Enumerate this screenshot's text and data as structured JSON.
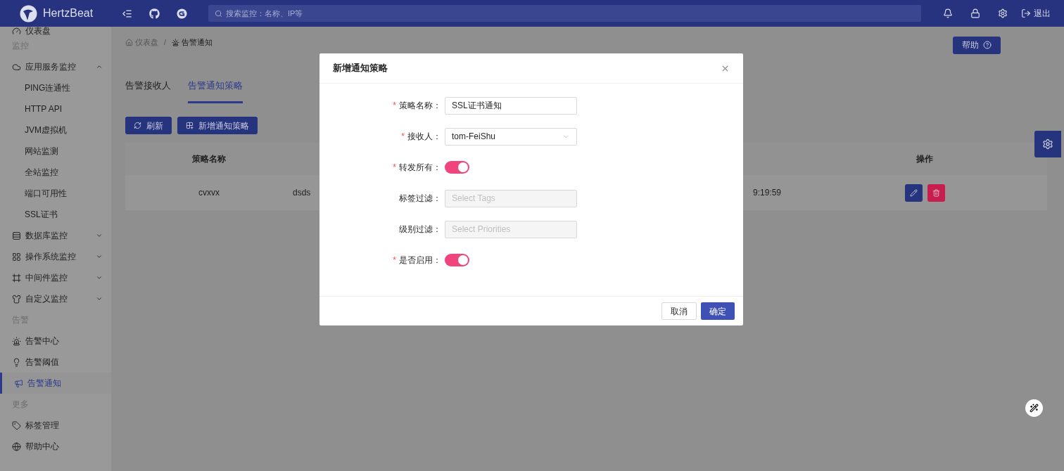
{
  "header": {
    "brand": "HertzBeat",
    "search": {
      "placeholder": "搜索监控：名称、IP等"
    },
    "logout": "退出"
  },
  "sidebar": {
    "items": [
      {
        "kind": "item",
        "label": "仪表盘",
        "selected": false
      },
      {
        "kind": "group",
        "label": "监控"
      },
      {
        "kind": "menu",
        "label": "应用服务监控",
        "expanded": true,
        "children": [
          {
            "label": "PING连通性",
            "selected": false
          },
          {
            "label": "HTTP API",
            "selected": false
          },
          {
            "label": "JVM虚拟机",
            "selected": false
          },
          {
            "label": "网站监测",
            "selected": false
          },
          {
            "label": "全站监控",
            "selected": false
          },
          {
            "label": "端口可用性",
            "selected": false
          },
          {
            "label": "SSL证书",
            "selected": false
          }
        ]
      },
      {
        "kind": "menu",
        "label": "数据库监控",
        "expanded": false
      },
      {
        "kind": "menu",
        "label": "操作系统监控",
        "expanded": false
      },
      {
        "kind": "menu",
        "label": "中间件监控",
        "expanded": false
      },
      {
        "kind": "menu",
        "label": "自定义监控",
        "expanded": false
      },
      {
        "kind": "group",
        "label": "告警"
      },
      {
        "kind": "item",
        "label": "告警中心",
        "selected": false
      },
      {
        "kind": "item",
        "label": "告警阈值",
        "selected": false
      },
      {
        "kind": "item",
        "label": "告警通知",
        "selected": true
      },
      {
        "kind": "group",
        "label": "更多"
      },
      {
        "kind": "item",
        "label": "标签管理",
        "selected": false
      },
      {
        "kind": "item",
        "label": "帮助中心",
        "selected": false
      }
    ]
  },
  "breadcrumb": {
    "items": [
      "仪表盘",
      "告警通知"
    ],
    "separator": "/"
  },
  "help_button": "帮助",
  "tabs": [
    {
      "label": "告警接收人",
      "selected": false
    },
    {
      "label": "告警通知策略",
      "selected": true
    }
  ],
  "toolbar": [
    "刷新",
    "新增通知策略"
  ],
  "table": {
    "columns": {
      "column_1": "策略名称",
      "column_4": "操作"
    },
    "rows": [
      [
        "cvxvx",
        "dsds",
        "9:19:59"
      ]
    ]
  },
  "modal": {
    "title": "新增通知策略",
    "fields": [
      {
        "kind": "input",
        "label": "策略名称：",
        "required_mark": "*",
        "value": "SSL证书通知"
      },
      {
        "kind": "select",
        "label": "接收人：",
        "required_mark": "*",
        "value": "tom-FeiShu",
        "disabled": false
      },
      {
        "kind": "switch",
        "label": "转发所有：",
        "required_mark": "*",
        "on": true
      },
      {
        "kind": "select",
        "label": "标签过滤：",
        "placeholder": "Select Tags",
        "disabled": true
      },
      {
        "kind": "select",
        "label": "级别过滤：",
        "placeholder": "Select Priorities",
        "disabled": true
      },
      {
        "kind": "switch",
        "label": "是否启用：",
        "required_mark": "*",
        "on": true
      }
    ],
    "buttons": [
      "取消",
      "确定"
    ]
  }
}
